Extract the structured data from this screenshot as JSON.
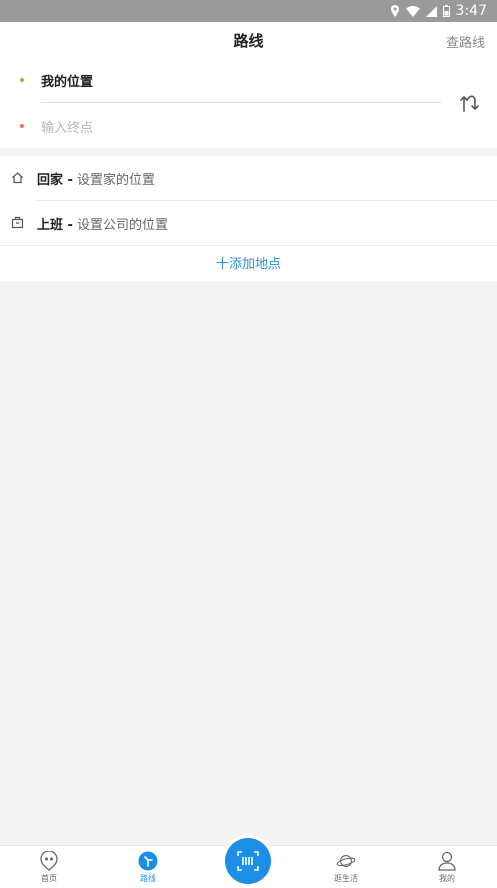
{
  "status_bar": {
    "time": "3:47"
  },
  "header": {
    "title": "路线",
    "right_action": "查路线"
  },
  "route": {
    "start": {
      "label": "我的位置",
      "dot_color": "#8bc34a"
    },
    "end": {
      "placeholder": "输入终点",
      "dot_color": "#f36c60"
    }
  },
  "places": {
    "items": [
      {
        "name": "回家 -",
        "desc": " 设置家的位置",
        "icon": "home-icon"
      },
      {
        "name": "上班 -",
        "desc": " 设置公司的位置",
        "icon": "briefcase-icon"
      }
    ],
    "add_label": "十添加地点"
  },
  "tabbar": {
    "items": [
      {
        "label": "首页",
        "icon": "home-face-icon",
        "active": false
      },
      {
        "label": "路线",
        "icon": "route-icon",
        "active": true
      },
      {
        "label": "",
        "icon": "scan-icon",
        "active": false
      },
      {
        "label": "逛生活",
        "icon": "planet-icon",
        "active": false
      },
      {
        "label": "我的",
        "icon": "person-icon",
        "active": false
      }
    ]
  },
  "colors": {
    "accent": "#1b8ee6",
    "link": "#2d8cd8"
  }
}
